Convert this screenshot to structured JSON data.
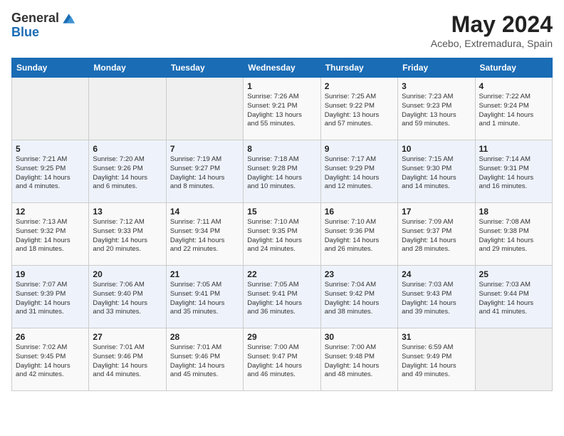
{
  "header": {
    "logo_general": "General",
    "logo_blue": "Blue",
    "month_year": "May 2024",
    "location": "Acebo, Extremadura, Spain"
  },
  "days_of_week": [
    "Sunday",
    "Monday",
    "Tuesday",
    "Wednesday",
    "Thursday",
    "Friday",
    "Saturday"
  ],
  "weeks": [
    [
      {
        "day": "",
        "info": ""
      },
      {
        "day": "",
        "info": ""
      },
      {
        "day": "",
        "info": ""
      },
      {
        "day": "1",
        "info": "Sunrise: 7:26 AM\nSunset: 9:21 PM\nDaylight: 13 hours\nand 55 minutes."
      },
      {
        "day": "2",
        "info": "Sunrise: 7:25 AM\nSunset: 9:22 PM\nDaylight: 13 hours\nand 57 minutes."
      },
      {
        "day": "3",
        "info": "Sunrise: 7:23 AM\nSunset: 9:23 PM\nDaylight: 13 hours\nand 59 minutes."
      },
      {
        "day": "4",
        "info": "Sunrise: 7:22 AM\nSunset: 9:24 PM\nDaylight: 14 hours\nand 1 minute."
      }
    ],
    [
      {
        "day": "5",
        "info": "Sunrise: 7:21 AM\nSunset: 9:25 PM\nDaylight: 14 hours\nand 4 minutes."
      },
      {
        "day": "6",
        "info": "Sunrise: 7:20 AM\nSunset: 9:26 PM\nDaylight: 14 hours\nand 6 minutes."
      },
      {
        "day": "7",
        "info": "Sunrise: 7:19 AM\nSunset: 9:27 PM\nDaylight: 14 hours\nand 8 minutes."
      },
      {
        "day": "8",
        "info": "Sunrise: 7:18 AM\nSunset: 9:28 PM\nDaylight: 14 hours\nand 10 minutes."
      },
      {
        "day": "9",
        "info": "Sunrise: 7:17 AM\nSunset: 9:29 PM\nDaylight: 14 hours\nand 12 minutes."
      },
      {
        "day": "10",
        "info": "Sunrise: 7:15 AM\nSunset: 9:30 PM\nDaylight: 14 hours\nand 14 minutes."
      },
      {
        "day": "11",
        "info": "Sunrise: 7:14 AM\nSunset: 9:31 PM\nDaylight: 14 hours\nand 16 minutes."
      }
    ],
    [
      {
        "day": "12",
        "info": "Sunrise: 7:13 AM\nSunset: 9:32 PM\nDaylight: 14 hours\nand 18 minutes."
      },
      {
        "day": "13",
        "info": "Sunrise: 7:12 AM\nSunset: 9:33 PM\nDaylight: 14 hours\nand 20 minutes."
      },
      {
        "day": "14",
        "info": "Sunrise: 7:11 AM\nSunset: 9:34 PM\nDaylight: 14 hours\nand 22 minutes."
      },
      {
        "day": "15",
        "info": "Sunrise: 7:10 AM\nSunset: 9:35 PM\nDaylight: 14 hours\nand 24 minutes."
      },
      {
        "day": "16",
        "info": "Sunrise: 7:10 AM\nSunset: 9:36 PM\nDaylight: 14 hours\nand 26 minutes."
      },
      {
        "day": "17",
        "info": "Sunrise: 7:09 AM\nSunset: 9:37 PM\nDaylight: 14 hours\nand 28 minutes."
      },
      {
        "day": "18",
        "info": "Sunrise: 7:08 AM\nSunset: 9:38 PM\nDaylight: 14 hours\nand 29 minutes."
      }
    ],
    [
      {
        "day": "19",
        "info": "Sunrise: 7:07 AM\nSunset: 9:39 PM\nDaylight: 14 hours\nand 31 minutes."
      },
      {
        "day": "20",
        "info": "Sunrise: 7:06 AM\nSunset: 9:40 PM\nDaylight: 14 hours\nand 33 minutes."
      },
      {
        "day": "21",
        "info": "Sunrise: 7:05 AM\nSunset: 9:41 PM\nDaylight: 14 hours\nand 35 minutes."
      },
      {
        "day": "22",
        "info": "Sunrise: 7:05 AM\nSunset: 9:41 PM\nDaylight: 14 hours\nand 36 minutes."
      },
      {
        "day": "23",
        "info": "Sunrise: 7:04 AM\nSunset: 9:42 PM\nDaylight: 14 hours\nand 38 minutes."
      },
      {
        "day": "24",
        "info": "Sunrise: 7:03 AM\nSunset: 9:43 PM\nDaylight: 14 hours\nand 39 minutes."
      },
      {
        "day": "25",
        "info": "Sunrise: 7:03 AM\nSunset: 9:44 PM\nDaylight: 14 hours\nand 41 minutes."
      }
    ],
    [
      {
        "day": "26",
        "info": "Sunrise: 7:02 AM\nSunset: 9:45 PM\nDaylight: 14 hours\nand 42 minutes."
      },
      {
        "day": "27",
        "info": "Sunrise: 7:01 AM\nSunset: 9:46 PM\nDaylight: 14 hours\nand 44 minutes."
      },
      {
        "day": "28",
        "info": "Sunrise: 7:01 AM\nSunset: 9:46 PM\nDaylight: 14 hours\nand 45 minutes."
      },
      {
        "day": "29",
        "info": "Sunrise: 7:00 AM\nSunset: 9:47 PM\nDaylight: 14 hours\nand 46 minutes."
      },
      {
        "day": "30",
        "info": "Sunrise: 7:00 AM\nSunset: 9:48 PM\nDaylight: 14 hours\nand 48 minutes."
      },
      {
        "day": "31",
        "info": "Sunrise: 6:59 AM\nSunset: 9:49 PM\nDaylight: 14 hours\nand 49 minutes."
      },
      {
        "day": "",
        "info": ""
      }
    ]
  ]
}
